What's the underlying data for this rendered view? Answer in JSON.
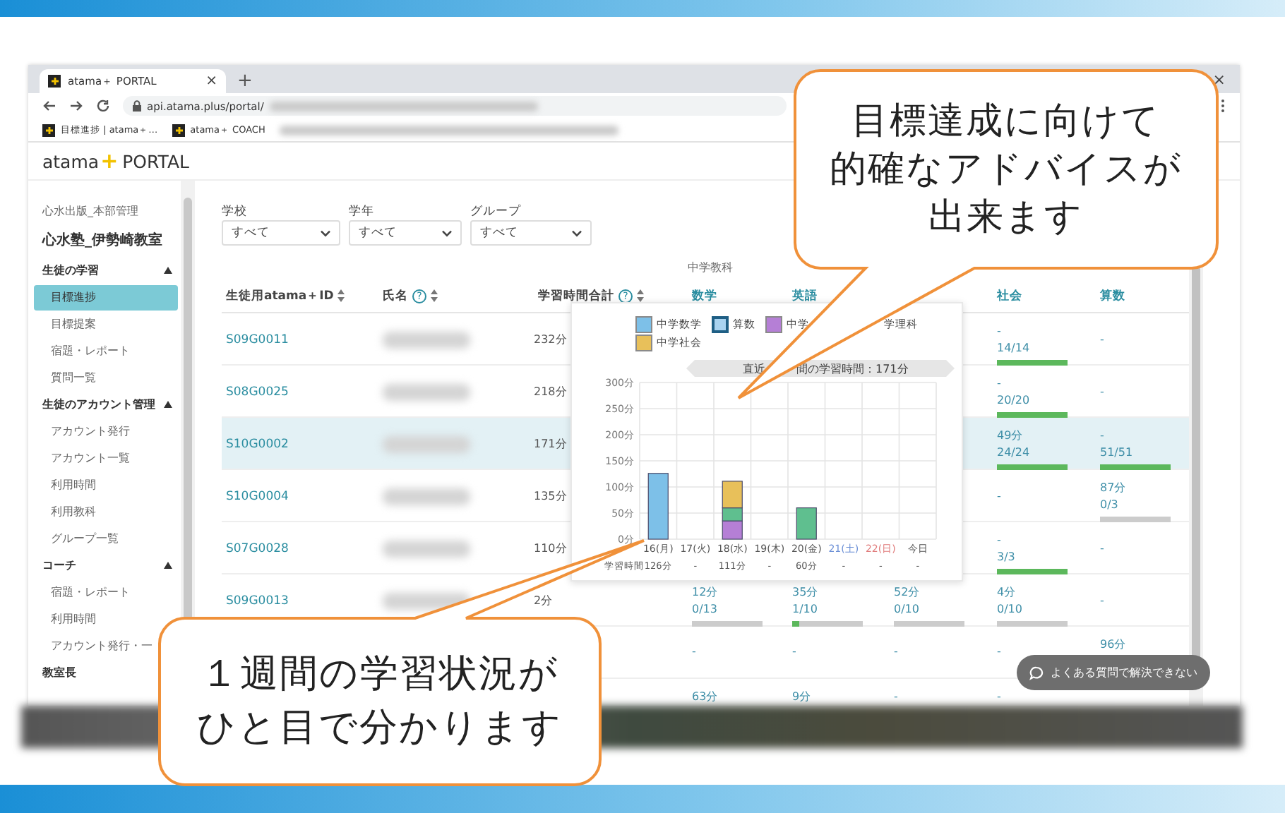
{
  "browser": {
    "tab": {
      "title": "atama＋ PORTAL",
      "close": "×"
    },
    "new_tab": "+",
    "window_close": "×",
    "url": "api.atama.plus/portal/",
    "bookmarks": [
      {
        "label": "目標進捗 | atama＋…"
      },
      {
        "label": "atama＋ COACH"
      }
    ]
  },
  "app": {
    "logo": {
      "name": "atama",
      "mark": "+",
      "product": "PORTAL"
    }
  },
  "sidebar": {
    "organization": "心水出版_本部管理",
    "school": "心水塾_伊勢崎教室",
    "sections": [
      {
        "title": "生徒の学習",
        "expanded": true,
        "items": [
          {
            "label": "目標進捗",
            "selected": true
          },
          {
            "label": "目標提案",
            "selected": false
          },
          {
            "label": "宿題・レポート",
            "selected": false
          },
          {
            "label": "質問一覧",
            "selected": false
          }
        ]
      },
      {
        "title": "生徒のアカウント管理",
        "expanded": true,
        "items": [
          {
            "label": "アカウント発行",
            "selected": false
          },
          {
            "label": "アカウント一覧",
            "selected": false
          },
          {
            "label": "利用時間",
            "selected": false
          },
          {
            "label": "利用教科",
            "selected": false
          },
          {
            "label": "グループ一覧",
            "selected": false
          }
        ]
      },
      {
        "title": "コーチ",
        "expanded": true,
        "items": [
          {
            "label": "宿題・レポート",
            "selected": false
          },
          {
            "label": "利用時間",
            "selected": false
          },
          {
            "label": "アカウント発行・一",
            "selected": false
          }
        ]
      },
      {
        "title": "教室長",
        "expanded": false
      }
    ]
  },
  "filters": [
    {
      "label": "学校",
      "value": "すべて"
    },
    {
      "label": "学年",
      "value": "すべて"
    },
    {
      "label": "グループ",
      "value": "すべて"
    }
  ],
  "table": {
    "group_header": "中学教科",
    "columns": [
      {
        "label": "生徒用atama＋ID",
        "sortable": true
      },
      {
        "label": "氏名",
        "help": "?",
        "sortable": true
      },
      {
        "label": "学習時間合計",
        "help": "?",
        "sortable": true
      }
    ],
    "subject_columns": {
      "math": "数学",
      "english": "英語",
      "social": "社会",
      "arithmetic": "算数"
    },
    "rows": [
      {
        "id": "S09G0011",
        "total": "232分",
        "selected": false,
        "social": {
          "kind": "stats",
          "time": "-",
          "progress": "14/14",
          "level": 1
        },
        "arithmetic": {
          "kind": "dash",
          "time": "-"
        }
      },
      {
        "id": "S08G0025",
        "total": "218分",
        "selected": false,
        "social": {
          "kind": "stats",
          "time": "-",
          "progress": "20/20",
          "level": 1
        },
        "arithmetic": {
          "kind": "dash",
          "time": "-"
        }
      },
      {
        "id": "S10G0002",
        "total": "171分",
        "selected": true,
        "social": {
          "kind": "stats",
          "time": "49分",
          "progress": "24/24",
          "level": 1
        },
        "arithmetic": {
          "kind": "stats",
          "time": "-",
          "progress": "51/51",
          "level": 1
        }
      },
      {
        "id": "S10G0004",
        "total": "135分",
        "selected": false,
        "social": {
          "kind": "dash",
          "time": "-"
        },
        "arithmetic": {
          "kind": "stats",
          "time": "87分",
          "progress": "0/3",
          "level": 0
        }
      },
      {
        "id": "S07G0028",
        "total": "110分",
        "selected": false,
        "social": {
          "kind": "stats",
          "time": "-",
          "progress": "3/3",
          "level": 1
        },
        "arithmetic": {
          "kind": "dash",
          "time": "-"
        }
      },
      {
        "id": "S09G0013",
        "total": "2分",
        "selected": false,
        "math": {
          "kind": "stats",
          "time": "12分",
          "progress": "0/13",
          "level": 0
        },
        "english": {
          "kind": "stats",
          "time": "35分",
          "progress": "1/10",
          "level": 0.1
        },
        "column_3": {
          "kind": "stats",
          "time": "52分",
          "progress": "0/10",
          "level": 0
        },
        "social": {
          "kind": "stats",
          "time": "4分",
          "progress": "0/10",
          "level": 0
        },
        "arithmetic": {
          "kind": "dash",
          "time": "-"
        }
      },
      {
        "selected": false,
        "math": {
          "kind": "dash",
          "time": "-"
        },
        "english": {
          "kind": "dash",
          "time": "-"
        },
        "column_3": {
          "kind": "dash",
          "time": "-"
        },
        "social": {
          "kind": "dash",
          "time": "-"
        },
        "arithmetic": {
          "kind": "stats",
          "time": "96分"
        }
      },
      {
        "selected": false,
        "math": {
          "kind": "stats",
          "time": "63分"
        },
        "english": {
          "kind": "stats",
          "time": "9分"
        },
        "column_3": {
          "kind": "stats",
          "time": "-"
        },
        "social": {
          "kind": "stats",
          "time": "-"
        }
      }
    ]
  },
  "chart_popup": {
    "legend": [
      {
        "kind": "swatch"
      },
      {
        "kind": "outlined"
      },
      {
        "kind": "swatch"
      },
      {
        "kind": "text_only"
      },
      {
        "kind": "swatch"
      }
    ],
    "title_parts": [
      "直近",
      "間の学習時間：171分"
    ],
    "row_label": "学習時間",
    "days": [
      {
        "kind": "weekday",
        "total": "126分"
      },
      {
        "kind": "weekday",
        "total": "-"
      },
      {
        "kind": "weekday",
        "total": "111分"
      },
      {
        "kind": "weekday",
        "total": "-"
      },
      {
        "kind": "weekday",
        "total": "60分"
      },
      {
        "kind": "saturday",
        "total": "-"
      },
      {
        "kind": "sunday",
        "total": "-"
      },
      {
        "kind": "today",
        "total": "-"
      }
    ],
    "chart_data": {
      "type": "bar",
      "stacked": true,
      "grid": true,
      "categories": [
        "16(月)",
        "17(火)",
        "18(水)",
        "19(木)",
        "20(金)",
        "21(土)",
        "22(日)",
        "今日"
      ],
      "ylim": [
        0,
        300
      ],
      "yticks": [
        {
          "value": 0,
          "label": "0分"
        },
        {
          "value": 50,
          "label": "50分"
        },
        {
          "value": 100,
          "label": "100分"
        },
        {
          "value": 150,
          "label": "150分"
        },
        {
          "value": 200,
          "label": "200分"
        },
        {
          "value": 250,
          "label": "250分"
        },
        {
          "value": 300,
          "label": "300分"
        }
      ],
      "series": [
        {
          "name": "中学数学",
          "color": "#7dc0e8",
          "values": [
            126,
            0,
            0,
            0,
            0,
            0,
            0,
            0
          ]
        },
        {
          "name": "算数",
          "color": "#a9d3f0",
          "values": [
            0,
            0,
            0,
            0,
            0,
            0,
            0,
            0
          ]
        },
        {
          "name": "中学",
          "color": "#b57fd6",
          "values": [
            0,
            0,
            35,
            0,
            0,
            0,
            0,
            0
          ]
        },
        {
          "name": "学理科",
          "color": "#5fbf8f",
          "values": [
            0,
            0,
            25,
            0,
            60,
            0,
            0,
            0
          ]
        },
        {
          "name": "中学社会",
          "color": "#e8c05a",
          "values": [
            0,
            0,
            51,
            0,
            0,
            0,
            0,
            0
          ]
        }
      ]
    }
  },
  "help_button": {
    "label": "よくある質問で解決できない"
  },
  "callouts": [
    {
      "lines": [
        "目標達成に向けて",
        "的確なアドバイスが",
        "出来ます"
      ]
    },
    {
      "lines": [
        "１週間の学習状況が",
        "ひと目で分かります"
      ]
    }
  ]
}
